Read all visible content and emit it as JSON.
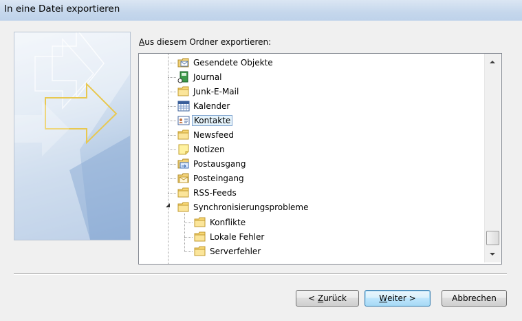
{
  "window": {
    "title": "In eine Datei exportieren"
  },
  "prompt": {
    "mnemonic": "A",
    "rest": "us diesem Ordner exportieren:"
  },
  "tree": {
    "items": [
      {
        "label": "Gesendete Objekte",
        "icon": "sent-items-icon",
        "level": 1
      },
      {
        "label": "Journal",
        "icon": "journal-icon",
        "level": 1
      },
      {
        "label": "Junk-E-Mail",
        "icon": "folder-icon",
        "level": 1
      },
      {
        "label": "Kalender",
        "icon": "calendar-icon",
        "level": 1
      },
      {
        "label": "Kontakte",
        "icon": "contacts-icon",
        "level": 1,
        "selected": true
      },
      {
        "label": "Newsfeed",
        "icon": "folder-icon",
        "level": 1
      },
      {
        "label": "Notizen",
        "icon": "notes-icon",
        "level": 1
      },
      {
        "label": "Postausgang",
        "icon": "outbox-icon",
        "level": 1
      },
      {
        "label": "Posteingang",
        "icon": "inbox-icon",
        "level": 1
      },
      {
        "label": "RSS-Feeds",
        "icon": "folder-icon",
        "level": 1
      },
      {
        "label": "Synchronisierungsprobleme",
        "icon": "folder-icon",
        "level": 1,
        "expanded": true
      },
      {
        "label": "Konflikte",
        "icon": "folder-icon",
        "level": 2
      },
      {
        "label": "Lokale Fehler",
        "icon": "folder-icon",
        "level": 2
      },
      {
        "label": "Serverfehler",
        "icon": "folder-icon",
        "level": 2
      }
    ]
  },
  "buttons": {
    "back": {
      "prefix": "< ",
      "mnemonic": "Z",
      "rest": "urück"
    },
    "next": {
      "mnemonic": "W",
      "rest": "eiter >"
    },
    "cancel": {
      "label": "Abbrechen"
    }
  },
  "colors": {
    "title_bar": "#c5d7ec",
    "selection_fill": "#e5f3fb",
    "selection_border": "#7da2ce",
    "banner_arrow": "#e8c850"
  }
}
